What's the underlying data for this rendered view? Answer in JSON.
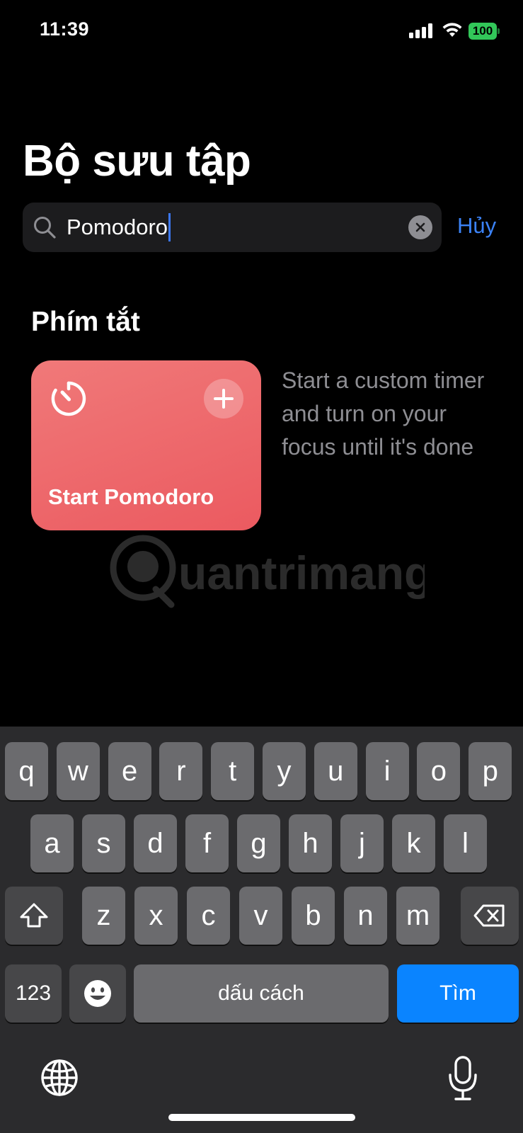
{
  "status_bar": {
    "time": "11:39",
    "battery": "100",
    "battery_color": "#32c759"
  },
  "header": {
    "title": "Bộ sưu tập"
  },
  "search": {
    "value": "Pomodoro",
    "cancel_label": "Hủy",
    "search_icon": "magnifier-icon",
    "clear_icon": "xmark-circle-icon"
  },
  "section": {
    "title": "Phím tắt",
    "shortcut": {
      "label": "Start Pomodoro",
      "description": "Start a custom timer and turn on your focus until it's done",
      "icon": "timer-icon",
      "add_icon": "plus-icon",
      "card_color": "#ef6066"
    }
  },
  "watermark": {
    "text": "uantrimang"
  },
  "keyboard": {
    "row1": [
      "q",
      "w",
      "e",
      "r",
      "t",
      "y",
      "u",
      "i",
      "o",
      "p"
    ],
    "row2": [
      "a",
      "s",
      "d",
      "f",
      "g",
      "h",
      "j",
      "k",
      "l"
    ],
    "row3": [
      "z",
      "x",
      "c",
      "v",
      "b",
      "n",
      "m"
    ],
    "numbers_label": "123",
    "space_label": "dấu cách",
    "return_label": "Tìm",
    "return_color": "#0a84ff",
    "shift_icon": "shift-icon",
    "delete_icon": "delete-backspace-icon",
    "emoji_icon": "emoji-face-icon",
    "globe_icon": "globe-icon",
    "mic_icon": "microphone-icon"
  }
}
